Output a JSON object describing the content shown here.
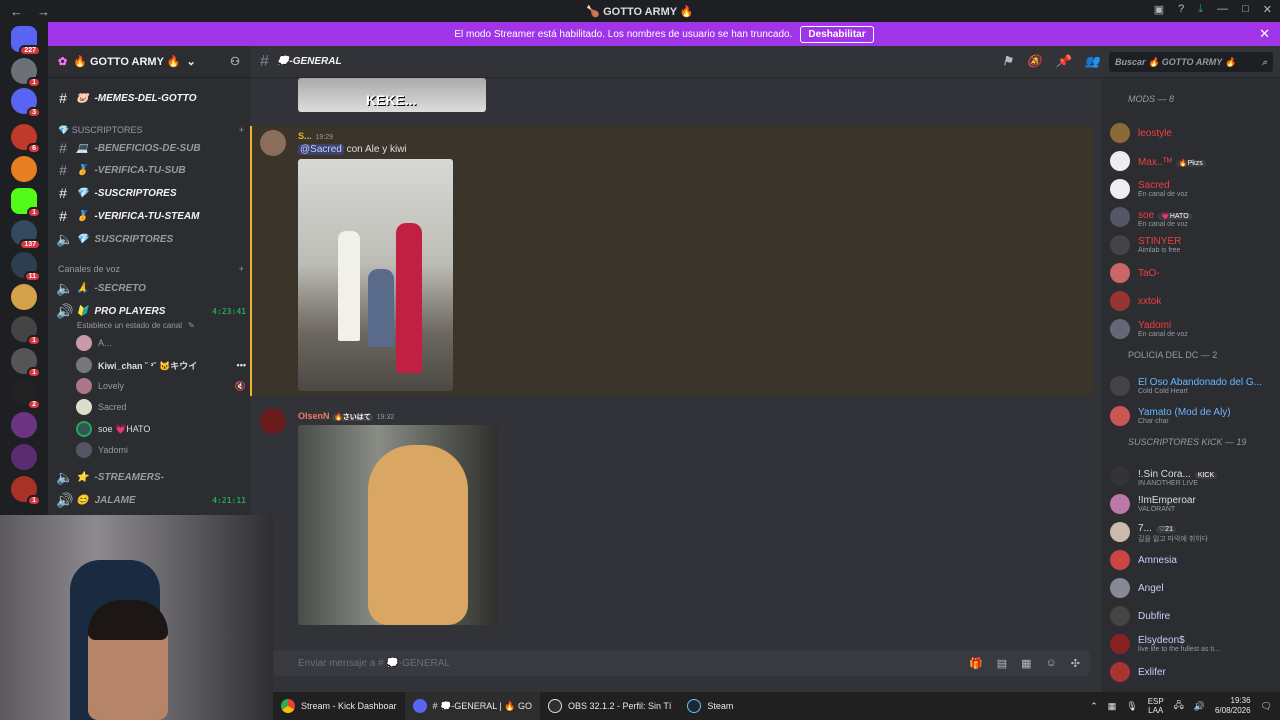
{
  "window": {
    "title": "🍗 GOTTO ARMY 🔥"
  },
  "banner": {
    "text": "El modo Streamer está habilitado. Los nombres de usuario se han truncado.",
    "button": "Deshabilitar"
  },
  "guild_badges": [
    "227",
    "1",
    "3",
    "6",
    "1",
    "137",
    "11",
    "1",
    "1",
    "2",
    "1"
  ],
  "server": {
    "name": "🔥 GOTTO ARMY 🔥"
  },
  "channels": [
    {
      "name": "-MEMES-DEL-GOTTO",
      "emoji": "🐷",
      "bright": true
    },
    {
      "name": "-BENEFICIOS-DE-SUB",
      "emoji": "💻",
      "bright": false
    },
    {
      "name": "-VERIFICA-TU-SUB",
      "emoji": "🏅",
      "bright": false
    },
    {
      "name": "-SUSCRIPTORES",
      "emoji": "💎",
      "bright": true
    },
    {
      "name": "-VERIFICA-TU-STEAM",
      "emoji": "🏅",
      "bright": true
    },
    {
      "name": "SUSCRIPTORES",
      "emoji": "💎",
      "bright": false
    }
  ],
  "cat_subs": "💎 SUSCRIPTORES",
  "cat_voice": "Canales de voz",
  "voice": [
    {
      "name": "-SECRETO",
      "emoji": "🙏"
    },
    {
      "name": "PRO PLAYERS",
      "emoji": "🔰",
      "time": "4:23:41",
      "status": "Establece un estado de canal"
    },
    {
      "name": "-STREAMERS-",
      "emoji": "⭐"
    },
    {
      "name": "JALAME",
      "emoji": "😊",
      "time": "4:21:11"
    }
  ],
  "voice_users": [
    "A...",
    "Kiwi_chan ˘ ³˘ 🐱キウイ",
    "Lovely",
    "Sacred",
    "soe 💗HATO",
    "Yadomi"
  ],
  "channel": {
    "name": "💭-GENERAL",
    "search": "Buscar 🔥 GOTTO ARMY 🔥"
  },
  "messages": [
    {
      "author": "S...",
      "time": "19:29",
      "mention": "@Sacred",
      "text": "con Ale y kiwi",
      "image_label": "image-photo-street"
    },
    {
      "author": "OlsenN",
      "badge": "🔥さいはて",
      "time": "19:32",
      "image_label": "cat-gif"
    }
  ],
  "top_image_text": "KEKE...",
  "composer": {
    "placeholder": "Enviar mensaje a # 💭-GENERAL"
  },
  "members": {
    "mods_header": "MODS — 8",
    "mods": [
      {
        "name": "leostyle",
        "status": "",
        "color": "#f23f43"
      },
      {
        "name": "Max..ᵀᴹ",
        "status": "",
        "color": "#f23f43",
        "tag": "🔥Pkzs"
      },
      {
        "name": "Sacred",
        "status": "En canal de voz",
        "color": "#f23f43"
      },
      {
        "name": "soe",
        "status": "En canal de voz",
        "color": "#f23f43",
        "tag": "💗HATO"
      },
      {
        "name": "STINYER",
        "status": "Aimlab is free",
        "color": "#f23f43"
      },
      {
        "name": "TaO-",
        "status": "",
        "color": "#f23f43"
      },
      {
        "name": "xxtok",
        "status": "",
        "color": "#f23f43"
      },
      {
        "name": "Yadomi",
        "status": "En canal de voz",
        "color": "#f23f43"
      }
    ],
    "police_header": "POLICIA DEL DC — 2",
    "police": [
      {
        "name": "El Oso Abandonado del G...",
        "status": "Cold Cold Heart",
        "color": "#6ab7ff"
      },
      {
        "name": "Yamato (Mod de Aly)",
        "status": "Char char",
        "color": "#6ab7ff"
      }
    ],
    "kick_header": "SUSCRIPTORES KICK — 19",
    "kick": [
      {
        "name": "!.Sin Cora...",
        "status": "IN ANOTHER LIVE",
        "color": "#dbdee1",
        "tag": "KICK"
      },
      {
        "name": "!ImEmperoar",
        "status": "VALORANT",
        "color": "#dbdee1"
      },
      {
        "name": "7...",
        "status": "길을 잃고 마악에 취하다",
        "color": "#dbdee1",
        "tag": "♡21"
      },
      {
        "name": "Amnesia",
        "status": "",
        "color": "#c9cdfb"
      },
      {
        "name": "Angel",
        "status": "",
        "color": "#c9cdfb"
      },
      {
        "name": "Dubfire",
        "status": "",
        "color": "#c9cdfb"
      },
      {
        "name": "Elsydeon$",
        "status": "live life to the fullest as ti...",
        "color": "#c9cdfb"
      },
      {
        "name": "Exlifer",
        "status": "",
        "color": "#c9cdfb"
      }
    ]
  },
  "taskbar": {
    "items": [
      "Stream - Kick Dashboar",
      "# 💭-GENERAL | 🔥 GO",
      "OBS 32.1.2 - Perfil: Sin Tí",
      "Steam"
    ],
    "lang": "ESP",
    "lang2": "LAA",
    "time": "19:36",
    "date": "6/08/2026"
  }
}
